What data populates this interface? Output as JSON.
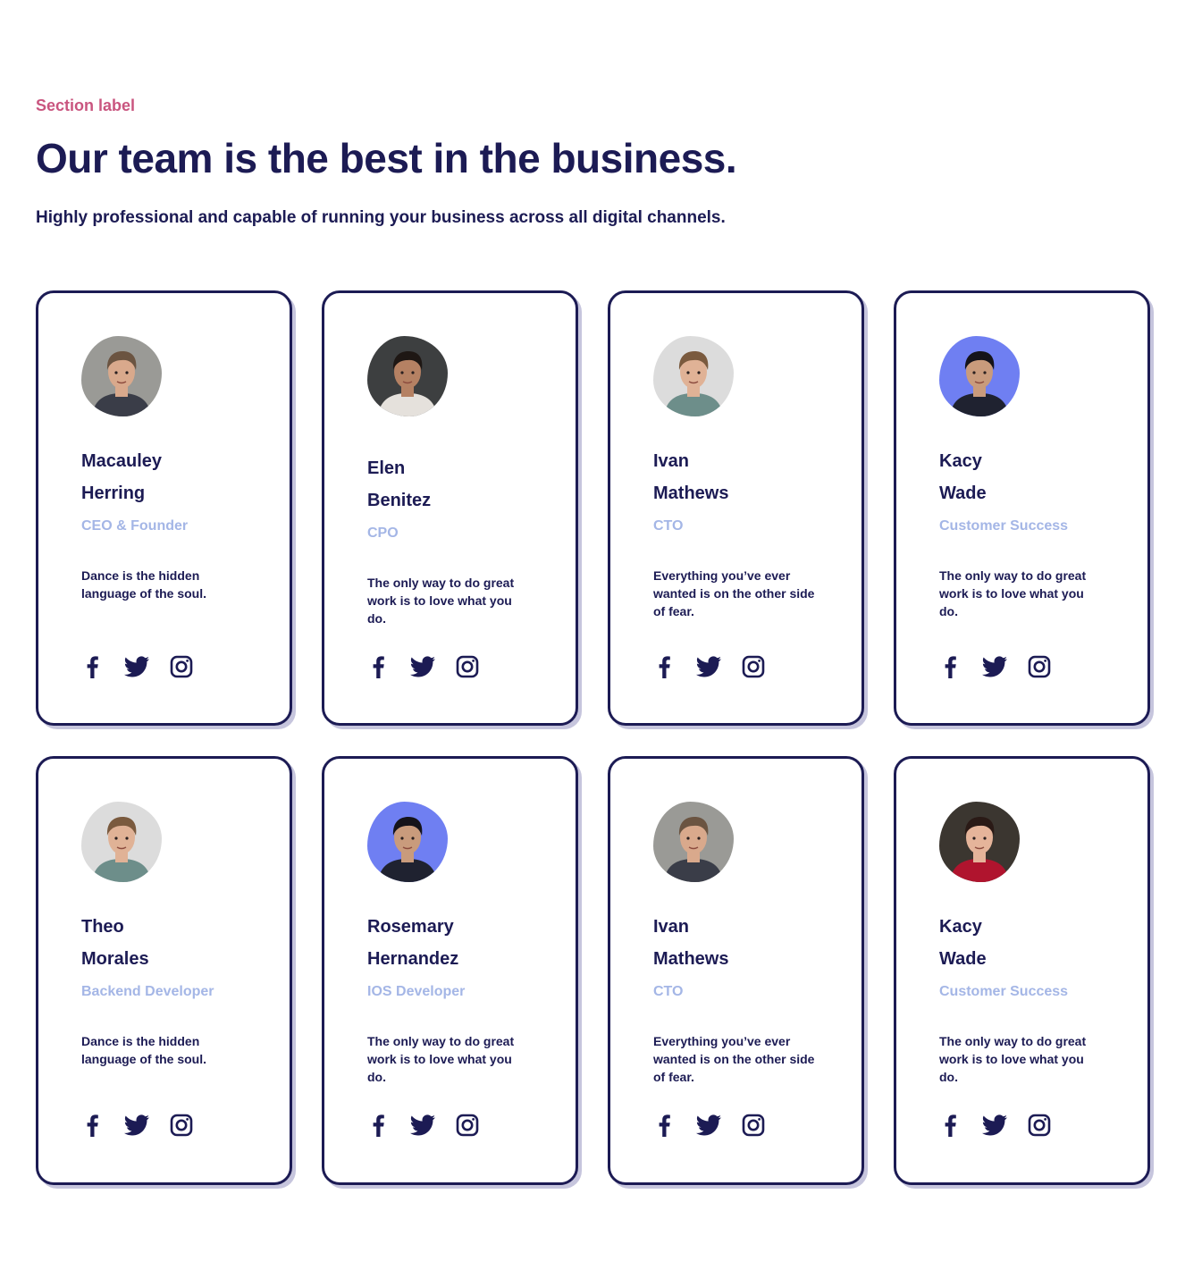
{
  "header": {
    "section_label": "Section label",
    "title": "Our team is the best in the business.",
    "subtitle": "Highly professional and capable of running your business across all digital channels."
  },
  "colors": {
    "heading": "#1c1b54",
    "label_accent": "#c9557f",
    "role_text": "#a4b6e6",
    "card_border": "#1c1b54",
    "card_shadow": "#c6c5dd"
  },
  "team": [
    {
      "first": "Macauley",
      "last": "Herring",
      "role": "CEO & Founder",
      "quote": "Dance is the hidden language of the soul.",
      "avatar_icon": "portrait-photo",
      "socials": [
        "facebook-icon",
        "twitter-icon",
        "instagram-icon"
      ]
    },
    {
      "first": "Elen",
      "last": "Benitez",
      "role": "CPO",
      "quote": "The only way to do great work is to love what you do.",
      "avatar_icon": "portrait-photo",
      "socials": [
        "facebook-icon",
        "twitter-icon",
        "instagram-icon"
      ]
    },
    {
      "first": "Ivan",
      "last": "Mathews",
      "role": "CTO",
      "quote": "Everything you’ve ever wanted is on the other side of fear.",
      "avatar_icon": "portrait-photo",
      "socials": [
        "facebook-icon",
        "twitter-icon",
        "instagram-icon"
      ]
    },
    {
      "first": "Kacy",
      "last": "Wade",
      "role": "Customer Success",
      "quote": "The only way to do great work is to love what you do.",
      "avatar_icon": "portrait-photo",
      "socials": [
        "facebook-icon",
        "twitter-icon",
        "instagram-icon"
      ]
    },
    {
      "first": "Theo",
      "last": "Morales",
      "role": "Backend Developer",
      "quote": "Dance is the hidden language of the soul.",
      "avatar_icon": "portrait-photo",
      "socials": [
        "facebook-icon",
        "twitter-icon",
        "instagram-icon"
      ]
    },
    {
      "first": "Rosemary",
      "last": "Hernandez",
      "role": "IOS Developer",
      "quote": "The only way to do great work is to love what you do.",
      "avatar_icon": "portrait-photo",
      "socials": [
        "facebook-icon",
        "twitter-icon",
        "instagram-icon"
      ]
    },
    {
      "first": "Ivan",
      "last": "Mathews",
      "role": "CTO",
      "quote": "Everything you’ve ever wanted is on the other side of fear.",
      "avatar_icon": "portrait-photo",
      "socials": [
        "facebook-icon",
        "twitter-icon",
        "instagram-icon"
      ]
    },
    {
      "first": "Kacy",
      "last": "Wade",
      "role": "Customer Success",
      "quote": "The only way to do great work is to love what you do.",
      "avatar_icon": "portrait-photo",
      "socials": [
        "facebook-icon",
        "twitter-icon",
        "instagram-icon"
      ]
    }
  ]
}
